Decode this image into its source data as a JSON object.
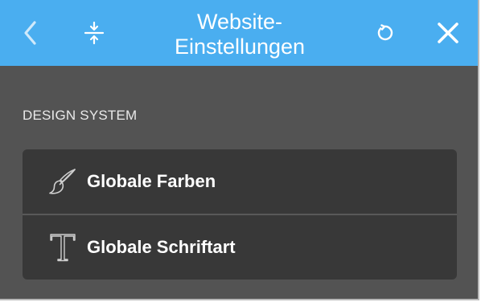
{
  "header": {
    "title_line1": "Website-",
    "title_line2": "Einstellungen",
    "back_icon": "chevron-left-icon",
    "collapse_icon": "collapse-vertical-icon",
    "reset_icon": "reset-icon",
    "close_icon": "close-icon",
    "background_color": "#4aaef0"
  },
  "section": {
    "label": "DESIGN SYSTEM"
  },
  "items": [
    {
      "label": "Globale Farben",
      "icon": "paintbrush-icon"
    },
    {
      "label": "Globale Schriftart",
      "icon": "typography-icon"
    }
  ],
  "colors": {
    "panel_background": "#535353",
    "list_background": "#383838",
    "text": "#ffffff"
  }
}
